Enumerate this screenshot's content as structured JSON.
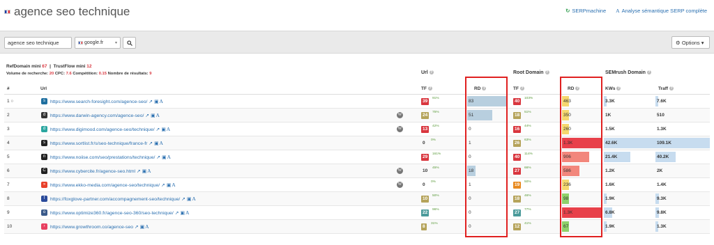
{
  "header": {
    "title": "agence seo technique",
    "links": [
      {
        "label": "SERPmachine",
        "icon": "serpmachine-icon"
      },
      {
        "label": "Analyse sémantique SERP complète",
        "icon": "semantic-a-icon"
      }
    ]
  },
  "search": {
    "query": "agence seo technique",
    "engine": "google.fr",
    "options_label": "Options"
  },
  "filters": {
    "refdomain_label": "RefDomain mini",
    "refdomain_value": "67",
    "trustflow_label": "TrustFlow mini",
    "trustflow_value": "12",
    "volume_label": "Volume de recherche:",
    "volume_value": "20",
    "cpc_label": "CPC:",
    "cpc_value": "7.6",
    "competition_label": "Compétition:",
    "competition_value": "0.15",
    "results_label": "Nombre de résultats:",
    "results_value": "9"
  },
  "groups": {
    "url": "Url",
    "root_domain": "Root Domain",
    "semrush": "SEMrush Domain"
  },
  "columns": {
    "num": "#",
    "url": "Url",
    "tf": "TF",
    "rd": "RD",
    "root_tf": "TF",
    "root_rd": "RD",
    "kws": "KWs",
    "traff": "Traff"
  },
  "rows": [
    {
      "num": "1",
      "num_icon": "circle-o-icon",
      "fav_color": "#1f6f9f",
      "fav_glyph": "s",
      "url": "https://www.search-foresight.com/agence-seo/",
      "wp": false,
      "tf": "39",
      "tf_color": "#d9363e",
      "tf_pct": "91%",
      "rd": "83",
      "rd_frac": 1.0,
      "root_tf": "40",
      "root_tf_color": "#d9363e",
      "root_pct": "103%",
      "root_rd": "463",
      "root_rd_frac": 0.18,
      "root_rd_color": "#f5d76e",
      "kws": "3.3K",
      "kws_frac": 0.03,
      "traff": "7.6K",
      "traff_frac": 0.03
    },
    {
      "num": "2",
      "num_icon": "",
      "fav_color": "#333333",
      "fav_glyph": "d",
      "url": "https://www.darwin-agency.com/agence-seo/",
      "wp": true,
      "tf": "24",
      "tf_color": "#b5a35a",
      "tf_pct": "75%",
      "rd": "51",
      "rd_frac": 0.65,
      "root_tf": "18",
      "root_tf_color": "#b5a35a",
      "root_pct": "51%",
      "root_rd": "350",
      "root_rd_frac": 0.14,
      "root_rd_color": "#f5d76e",
      "kws": "1K",
      "kws_frac": 0.0,
      "traff": "510",
      "traff_frac": 0.0
    },
    {
      "num": "3",
      "num_icon": "",
      "fav_color": "#2aa6a0",
      "fav_glyph": "d",
      "url": "https://www.digimood.com/agence-seo/technique/",
      "wp": true,
      "tf": "13",
      "tf_color": "#d9363e",
      "tf_pct": "42%",
      "rd": "0",
      "rd_frac": 0.0,
      "root_tf": "16",
      "root_tf_color": "#d9363e",
      "root_pct": "44%",
      "root_rd": "260",
      "root_rd_frac": 0.0,
      "root_rd_color": "#f5d76e",
      "kws": "1.5K",
      "kws_frac": 0.0,
      "traff": "1.3K",
      "traff_frac": 0.0
    },
    {
      "num": "4",
      "num_icon": "",
      "fav_color": "#222222",
      "fav_glyph": "s",
      "url": "https://www.sortlist.fr/s/seo-technique/france-fr",
      "wp": false,
      "tf": "0",
      "tf_color": "",
      "tf_pct": "0%",
      "rd": "1",
      "rd_frac": 0.0,
      "root_tf": "26",
      "root_tf_color": "#b5a35a",
      "root_pct": "63%",
      "root_rd": "1.3K",
      "root_rd_frac": 1.0,
      "root_rd_color": "#e8404a",
      "kws": "42.6K",
      "kws_frac": 1.0,
      "traff": "109.1K",
      "traff_frac": 1.0
    },
    {
      "num": "5",
      "num_icon": "",
      "fav_color": "#222222",
      "fav_glyph": "n",
      "url": "https://www.noiise.com/seo/prestations/technique/",
      "wp": false,
      "tf": "29",
      "tf_color": "#d9363e",
      "tf_pct": "161%",
      "rd": "0",
      "rd_frac": 0.0,
      "root_tf": "40",
      "root_tf_color": "#d9363e",
      "root_pct": "114%",
      "root_rd": "906",
      "root_rd_frac": 0.7,
      "root_rd_color": "#f2877c",
      "kws": "21.4K",
      "kws_frac": 0.5,
      "traff": "40.2K",
      "traff_frac": 0.37
    },
    {
      "num": "6",
      "num_icon": "",
      "fav_color": "#222222",
      "fav_glyph": "C",
      "url": "https://www.cybercite.fr/agence-seo.html",
      "wp": true,
      "tf": "10",
      "tf_color": "",
      "tf_pct": "45%",
      "rd": "18",
      "rd_frac": 0.22,
      "root_tf": "27",
      "root_tf_color": "#d9363e",
      "root_pct": "66%",
      "root_rd": "586",
      "root_rd_frac": 0.44,
      "root_rd_color": "#f2877c",
      "kws": "1.2K",
      "kws_frac": 0.0,
      "traff": "2K",
      "traff_frac": 0.0
    },
    {
      "num": "7",
      "num_icon": "",
      "fav_color": "#e8402a",
      "fav_glyph": "»",
      "url": "https://www.ekko-media.com/agence-seo/technique/",
      "wp": true,
      "tf": "0",
      "tf_color": "",
      "tf_pct": "0%",
      "rd": "1",
      "rd_frac": 0.0,
      "root_tf": "19",
      "root_tf_color": "#e88a20",
      "root_pct": "50%",
      "root_rd": "236",
      "root_rd_frac": 0.08,
      "root_rd_color": "#f5d76e",
      "kws": "1.6K",
      "kws_frac": 0.0,
      "traff": "1.4K",
      "traff_frac": 0.0
    },
    {
      "num": "8",
      "num_icon": "",
      "fav_color": "#2a4a9a",
      "fav_glyph": "f",
      "url": "https://foxglove-partner.com/accompagnement-seo/technique/",
      "wp": false,
      "tf": "10",
      "tf_color": "#b5a35a",
      "tf_pct": "50%",
      "rd": "0",
      "rd_frac": 0.0,
      "root_tf": "18",
      "root_tf_color": "#b5a35a",
      "root_pct": "46%",
      "root_rd": "98",
      "root_rd_frac": 0.06,
      "root_rd_color": "#8fd16a",
      "kws": "1.9K",
      "kws_frac": 0.04,
      "traff": "9.3K",
      "traff_frac": 0.07
    },
    {
      "num": "9",
      "num_icon": "",
      "fav_color": "#3a5a8a",
      "fav_glyph": "o",
      "url": "https://www.optimize360.fr/agence-seo-360/seo-technique/",
      "wp": false,
      "tf": "22",
      "tf_color": "#4a9a9a",
      "tf_pct": "96%",
      "rd": "0",
      "rd_frac": 0.0,
      "root_tf": "27",
      "root_tf_color": "#4a9a9a",
      "root_pct": "77%",
      "root_rd": "1.3K",
      "root_rd_frac": 1.0,
      "root_rd_color": "#e8404a",
      "kws": "6.8K",
      "kws_frac": 0.16,
      "traff": "9.8K",
      "traff_frac": 0.07
    },
    {
      "num": "10",
      "num_icon": "",
      "fav_color": "#e84060",
      "fav_glyph": "›",
      "url": "https://www.growthroom.co/agence-seo",
      "wp": false,
      "tf": "8",
      "tf_color": "#b5a35a",
      "tf_pct": "31%",
      "rd": "0",
      "rd_frac": 0.0,
      "root_tf": "12",
      "root_tf_color": "#b5a35a",
      "root_pct": "41%",
      "root_rd": "67",
      "root_rd_frac": 0.0,
      "root_rd_color": "#8fd16a",
      "kws": "1.9K",
      "kws_frac": 0.03,
      "traff": "1.3K",
      "traff_frac": 0.03
    }
  ]
}
